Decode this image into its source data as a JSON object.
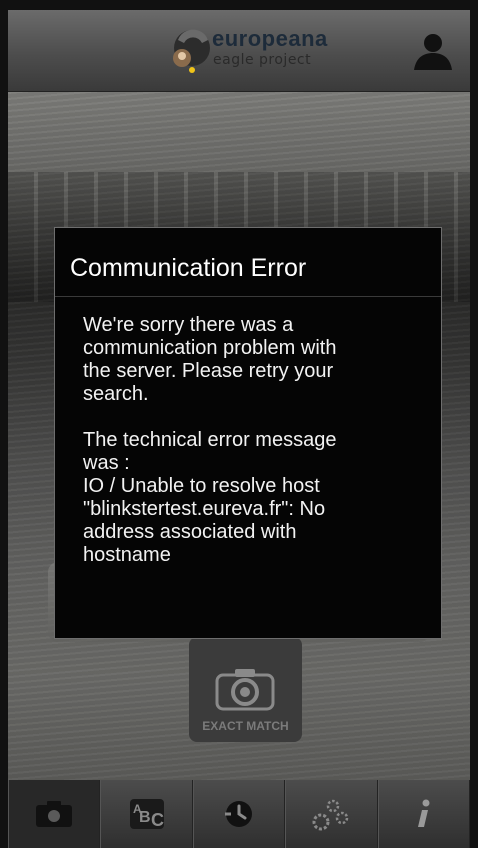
{
  "app": {
    "logo_title": "europeana",
    "logo_subtitle": "eagle project",
    "logo_icon": "europeana-eagle-logo",
    "profile_icon": "person-icon"
  },
  "dialog": {
    "title": "Communication Error",
    "paragraph1": "We're sorry there was a\ncommunication problem with\nthe server. Please retry your\nsearch.",
    "paragraph2": "The technical error message\nwas :\nIO / Unable to resolve host\n\"blinkstertest.eureva.fr\": No\naddress associated with\nhostname"
  },
  "exact_match": {
    "label": "EXACT MATCH",
    "icon": "camera-icon"
  },
  "bottom_tabs": [
    {
      "name": "camera",
      "icon": "camera-icon",
      "active": true
    },
    {
      "name": "text",
      "icon": "abc-text-icon",
      "active": false
    },
    {
      "name": "history",
      "icon": "history-icon",
      "active": false
    },
    {
      "name": "settings",
      "icon": "gears-icon",
      "active": false
    },
    {
      "name": "info",
      "icon": "info-icon",
      "active": false
    }
  ],
  "colors": {
    "dialog_bg": "#050505",
    "dialog_border": "#6e6e6e",
    "bar_bg": "#4d4d4d",
    "icon_gray": "#8a8a8a"
  }
}
